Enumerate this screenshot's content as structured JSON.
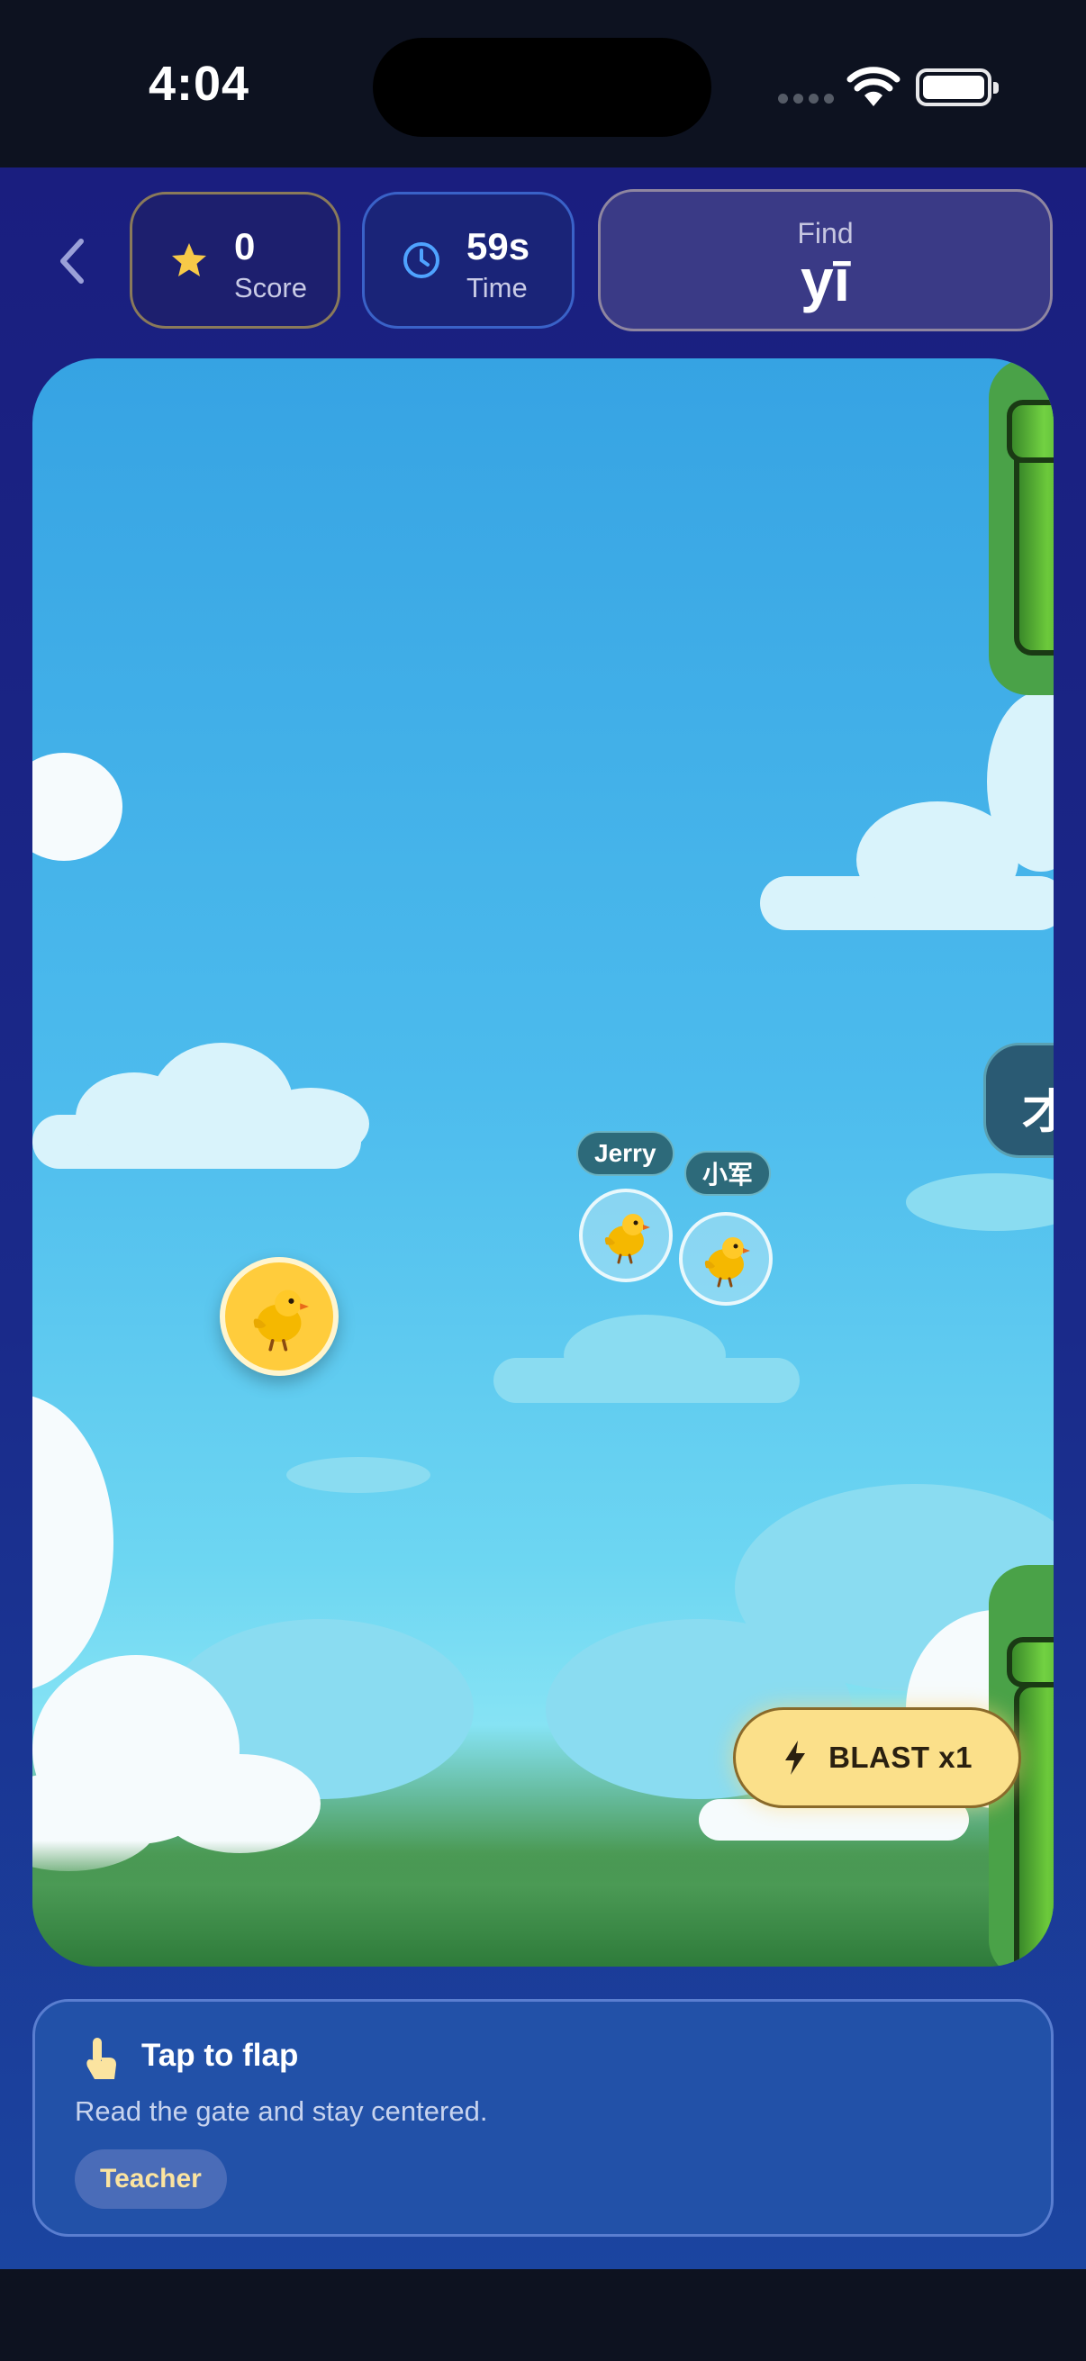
{
  "status_bar": {
    "time": "4:04"
  },
  "header": {
    "score": {
      "value": "0",
      "label": "Score"
    },
    "time": {
      "value": "59s",
      "label": "Time"
    },
    "find": {
      "label": "Find",
      "target": "yī"
    }
  },
  "game": {
    "gate_glyph": "才",
    "rivals": [
      {
        "name": "Jerry"
      },
      {
        "name": "小军"
      }
    ],
    "blast_label": "BLAST x1"
  },
  "hint": {
    "title": "Tap to flap",
    "body": "Read the gate and stay centered.",
    "role": "Teacher"
  },
  "colors": {
    "accent_yellow": "#fbe08a",
    "star": "#f7c948",
    "clock": "#4fa3ff",
    "pipe_green": "#4aa248"
  },
  "icons": [
    "back-chevron-icon",
    "star-icon",
    "clock-icon",
    "bolt-icon",
    "tap-hand-icon",
    "chick-icon"
  ]
}
